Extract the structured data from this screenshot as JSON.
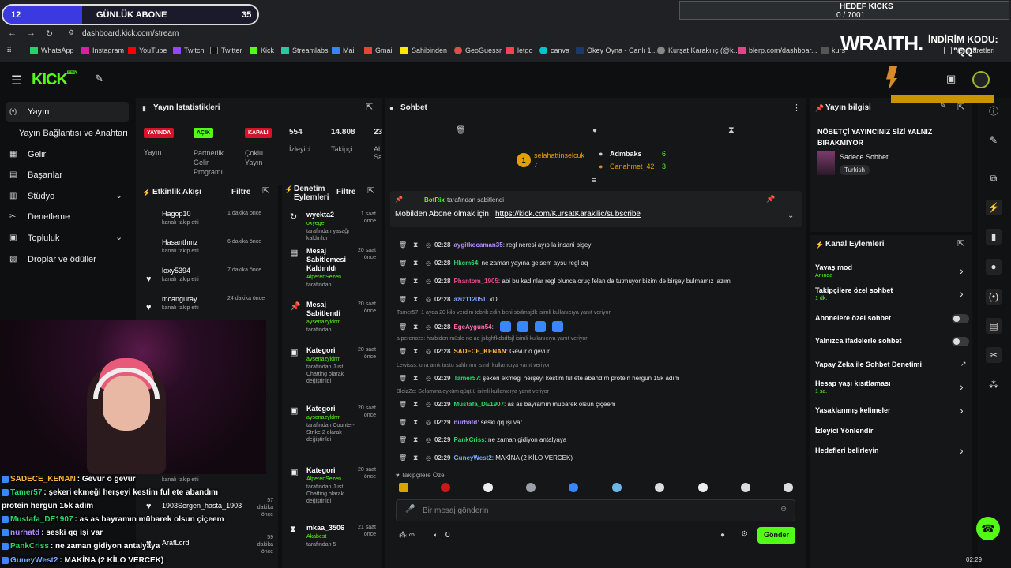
{
  "overlay": {
    "goal_left": "12",
    "goal_title": "GÜNLÜK ABONE",
    "goal_right": "35",
    "kicks_title": "HEDEF KICKS",
    "kicks_value": "0 / 7001",
    "brand": "WRAITH.",
    "promo": "İNDİRİM KODU:",
    "promo_code": "\"QQ\""
  },
  "browser": {
    "url": "dashboard.kick.com/stream",
    "bookmarks": [
      "WhatsApp",
      "Instagram",
      "YouTube",
      "Twitch",
      "Twitter",
      "Kick",
      "Streamlabs",
      "Mail",
      "Gmail",
      "Sahibinden",
      "GeoGuessr",
      "letgo",
      "canva",
      "Okey Oyna - Canlı 1...",
      "Kurşat Karakılıç (@k...",
      "blerp.com/dashboar...",
      "kurs"
    ],
    "bookmarks_label": "Yer İşaretleri"
  },
  "sidebar": {
    "items": [
      "Yayın",
      "Yayın Bağlantısı ve Anahtarı",
      "Gelir",
      "Başarılar",
      "Stüdyo",
      "Denetleme",
      "Topluluk",
      "Droplar ve ödüller"
    ]
  },
  "stats": {
    "title": "Yayın İstatistikleri",
    "yayin_badge": "YAYINDA",
    "yayin_label": "Yayın",
    "partner_badge": "AÇIK",
    "partner_label": "Partnerlik Gelir Programı",
    "coklu_badge": "KAPALI",
    "coklu_label": "Çoklu Yayın",
    "viewers": "554",
    "viewers_label": "İzleyici",
    "followers": "14.808",
    "followers_label": "Takipçi",
    "extra": "23",
    "extra_label": "Ab Sa"
  },
  "events": {
    "title": "Etkinlik Akışı",
    "filter": "Filtre",
    "items": [
      {
        "name": "Hagop10",
        "sub": "kanalı takip etti",
        "time": "1 dakika önce"
      },
      {
        "name": "Hasanthmz",
        "sub": "kanalı takip etti",
        "time": "6 dakika önce"
      },
      {
        "name": "loxy5394",
        "sub": "kanalı takip etti",
        "time": "7 dakika önce"
      },
      {
        "name": "mcanguray",
        "sub": "kanalı takip etti",
        "time": "24 dakika önce"
      }
    ],
    "lower": [
      {
        "name": "kanalı takip etti",
        "sub": "",
        "time": ""
      },
      {
        "name": "1903Sergen_hasta_1903",
        "sub": "",
        "time": "57 dakika önce"
      },
      {
        "name": "ArafLord",
        "sub": "",
        "time": "59 dakika önce"
      }
    ]
  },
  "mod": {
    "title": "Denetim Eylemleri",
    "filter": "Filtre",
    "items": [
      {
        "title": "wyekta2",
        "desc_user": "oxyege",
        "desc": "tarafından yasağı kaldırıldı",
        "time": "1 saat önce"
      },
      {
        "title": "Mesaj Sabitlemesi Kaldırıldı",
        "desc_user": "AlperenSezen",
        "desc": "tarafından",
        "time": "20 saat önce"
      },
      {
        "title": "Mesaj Sabitlendi",
        "desc_user": "aysenazyldrm",
        "desc": "tarafından",
        "time": "20 saat önce"
      },
      {
        "title": "Kategori",
        "desc_user": "aysenazyldrm",
        "desc": "tarafından Just Chatting olarak değiştirildi",
        "time": "20 saat önce"
      },
      {
        "title": "Kategori",
        "desc_user": "aysenazyldrm",
        "desc": "tarafından Counter-Strike 2 olarak değiştirildi",
        "time": "20 saat önce"
      },
      {
        "title": "Kategori",
        "desc_user": "AlperenSezen",
        "desc": "tarafından Just Chatting olarak değiştirildi",
        "time": "20 saat önce"
      },
      {
        "title": "mkaa_3506",
        "desc_user": "Akabest",
        "desc": "tarafından 5",
        "time": "21 saat önce"
      }
    ]
  },
  "chat": {
    "title": "Sohbet",
    "top1_name": "selahattinselcuk",
    "top1_val": "7",
    "top2_name": "Admbaks",
    "top2_val": "6",
    "top3_name": "Canahmet_42",
    "top3_val": "3",
    "pinned_by": "BotRix",
    "pinned_label": "tarafından sabitlendi",
    "pinned_text": "Mobilden Abone olmak için;",
    "pinned_link": "https://kick.com/KursatKarakilic/subscribe",
    "messages": [
      {
        "time": "02:28",
        "user": "aygitkocaman35",
        "color": "#b48cff",
        "text": ": regl neresi ayıp la insani bişey"
      },
      {
        "time": "02:28",
        "user": "Hkcm64",
        "color": "#2bd86c",
        "text": ": ne zaman yayına gelsem aysu regl aq"
      },
      {
        "time": "02:28",
        "user": "Phantom_1905",
        "color": "#e04a8e",
        "text": ": abi bu kadınlar regl olunca oruç felan da tutmuyor bizim de birşey bulmamız lazım"
      },
      {
        "time": "02:28",
        "user": "aziz112051",
        "color": "#7aa7ff",
        "text": ": xD"
      },
      {
        "time": "02:28",
        "user": "EgeAygun54",
        "color": "#ff6fb0",
        "text": ":"
      },
      {
        "time": "02:28",
        "user": "SADECE_KENAN",
        "color": "#ffb640",
        "text": ": Gevur o gevur"
      },
      {
        "time": "02:29",
        "user": "Tamer57",
        "color": "#2bd86c",
        "text": ": şekeri ekmeği herşeyi kestim ful ete abandım protein hergün 15k adım"
      },
      {
        "time": "02:29",
        "user": "Mustafa_DE1907",
        "color": "#2bd86c",
        "text": ": as as bayramın mübarek olsun çiçeem"
      },
      {
        "time": "02:29",
        "user": "nurhatd",
        "color": "#b48cff",
        "text": ": seski qq işi var"
      },
      {
        "time": "02:29",
        "user": "PankCriss",
        "color": "#2bd86c",
        "text": ": ne zaman gidiyon antalyaya"
      },
      {
        "time": "02:29",
        "user": "GuneyWest2",
        "color": "#7aa7ff",
        "text": ": MAKİNA (2 KİLO VERCEK)"
      }
    ],
    "replies": [
      "Tamer57: 1 ayda 20 kilo verdim tebrik edin beni sbdmsjdk isimli kullanıcıya yanıt veriyor",
      "alperenozs: harbiden müslo ne aq jskghfkdsdfsjl isimli kullanıcıya yanıt veriyor",
      "Lewisss: oha amk tostu saldırımı isimli kullanıcıya yanıt veriyor",
      "BloizZe: Selamınaleyküm qüqüü isimli kullanıcıya yanıt veriyor"
    ],
    "followers_only": "Takipçilere Özel",
    "input_placeholder": "Bir mesaj gönderin",
    "count": "0",
    "send": "Gönder"
  },
  "info": {
    "title": "Yayın bilgisi",
    "stream_title": "NÖBETÇİ YAYINCINIZ SİZİ YALNIZ BIRAKMIYOR",
    "category": "Sadece Sohbet",
    "tag": "Turkish"
  },
  "channel": {
    "title": "Kanal Eylemleri",
    "slow": "Yavaş mod",
    "slow_val": "Anında",
    "followers_chat": "Takipçilere özel sohbet",
    "followers_val": "1 dk.",
    "subs": "Abonelere özel sohbet",
    "emotes": "Yalnızca ifadelerle sohbet",
    "ai": "Yapay Zeka ile Sohbet Denetimi",
    "age": "Hesap yaşı kısıtlaması",
    "age_val": "1 sa.",
    "banned": "Yasaklanmış kelimeler",
    "redirect": "İzleyici Yönlendir",
    "goals": "Hedefleri belirleyin"
  },
  "overlay_chat": [
    {
      "user": "SADECE_KENAN",
      "color": "#ffb640",
      "text": ": Gevur o gevur"
    },
    {
      "user": "Tamer57",
      "color": "#2bd86c",
      "text": ": şekeri ekmeği herşeyi kestim ful ete abandım"
    },
    {
      "user": "",
      "color": "#ffffff",
      "text": "protein hergün 15k adım"
    },
    {
      "user": "Mustafa_DE1907",
      "color": "#2bd86c",
      "text": ": as as bayramın mübarek olsun çiçeem"
    },
    {
      "user": "nurhatd",
      "color": "#b48cff",
      "text": ": seski qq işi var"
    },
    {
      "user": "PankCriss",
      "color": "#2bd86c",
      "text": ": ne zaman gidiyon antalyaya"
    },
    {
      "user": "GuneyWest2",
      "color": "#7aa7ff",
      "text": ": MAKİNA (2 KİLO VERCEK)"
    }
  ],
  "clock": "02:29",
  "colors": {
    "kick_green": "#53fc18",
    "badge_red": "#d4142a"
  }
}
